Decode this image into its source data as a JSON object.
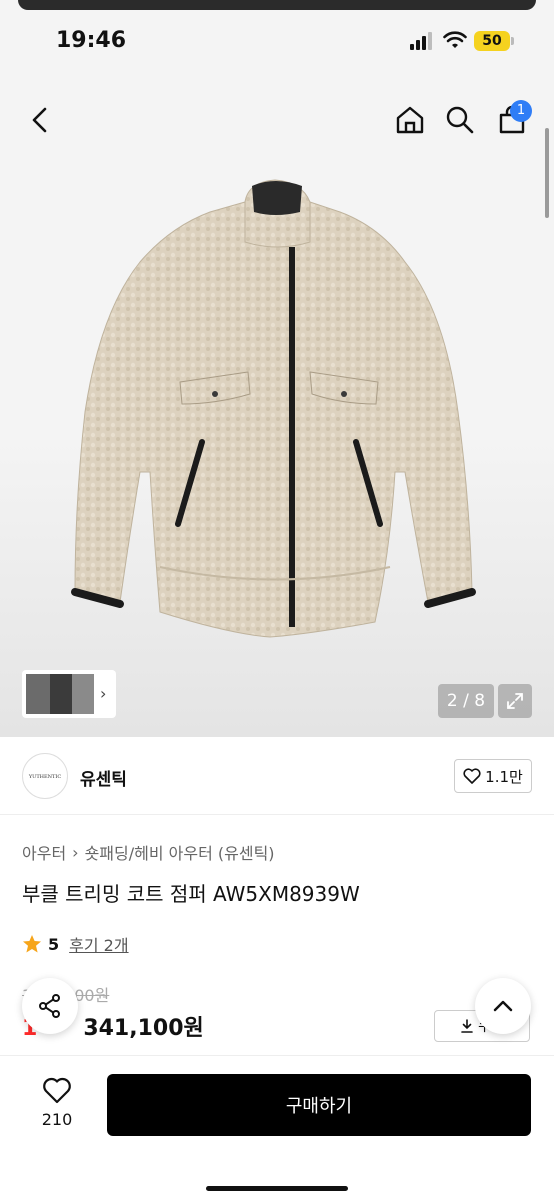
{
  "status": {
    "time": "19:46",
    "battery": "50"
  },
  "nav": {
    "cart_count": "1"
  },
  "gallery": {
    "counter": "2 / 8"
  },
  "brand": {
    "logo_text": "YUTHENTIC",
    "name": "유센틱",
    "likes": "1.1만"
  },
  "product": {
    "breadcrumb": [
      "아우터",
      "숏패딩/헤비 아우터 (유센틱)"
    ],
    "title": "부클 트리밍 코트 점퍼 AW5XM8939W",
    "rating": "5",
    "reviews": "후기 2개",
    "original_price": "3",
    "original_price_tail": "00원",
    "discount": "1",
    "sale_price": "341,100원"
  },
  "coupon": {
    "label": "쿠폰"
  },
  "bottom": {
    "wish_count": "210",
    "buy_label": "구매하기"
  },
  "colors": {
    "accent_blue": "#2f7df6",
    "discount_red": "#ff2b2b",
    "battery_yellow": "#f5d21f"
  }
}
